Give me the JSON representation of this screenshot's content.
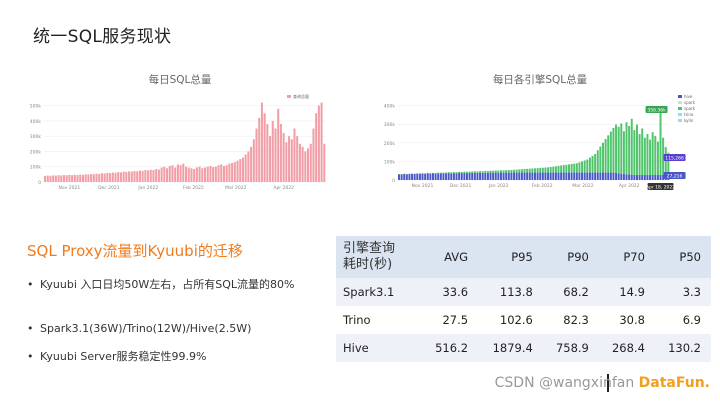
{
  "slide": {
    "title": "统一SQL服务现状"
  },
  "left_chart": {
    "title": "每日SQL总量",
    "chart_data": {
      "type": "bar",
      "title": "每日SQL总量",
      "legend": [
        "查询总量"
      ],
      "yticks": [
        "0",
        "100k",
        "200k",
        "300k",
        "400k",
        "500k"
      ],
      "ylim": [
        0,
        550000
      ],
      "xticks": [
        "Nov 2021",
        "Dec 2021",
        "Jan 2022",
        "Feb 2022",
        "Mar 2022",
        "Apr 2022"
      ],
      "series": [
        {
          "name": "查询总量",
          "color": "#f29ea6",
          "values": [
            40000,
            42000,
            41000,
            43000,
            42000,
            44000,
            43000,
            45000,
            44000,
            46000,
            45000,
            47000,
            46000,
            48000,
            47000,
            50000,
            49000,
            52000,
            51000,
            55000,
            53000,
            58000,
            56000,
            60000,
            58000,
            62000,
            60000,
            65000,
            63000,
            68000,
            66000,
            70000,
            68000,
            72000,
            70000,
            75000,
            73000,
            78000,
            76000,
            80000,
            78000,
            85000,
            82000,
            95000,
            100000,
            90000,
            105000,
            110000,
            95000,
            115000,
            110000,
            120000,
            100000,
            95000,
            90000,
            85000,
            95000,
            100000,
            90000,
            95000,
            100000,
            105000,
            98000,
            100000,
            110000,
            115000,
            105000,
            110000,
            120000,
            125000,
            130000,
            140000,
            150000,
            160000,
            180000,
            200000,
            230000,
            280000,
            350000,
            420000,
            520000,
            450000,
            380000,
            300000,
            400000,
            350000,
            480000,
            380000,
            320000,
            260000,
            300000,
            280000,
            350000,
            300000,
            250000,
            230000,
            200000,
            220000,
            250000,
            350000,
            450000,
            500000,
            520000,
            250000
          ]
        }
      ]
    }
  },
  "right_chart": {
    "title": "每日各引擎SQL总量",
    "chart_data": {
      "type": "bar",
      "title": "每日各引擎SQL总量",
      "legend": [
        "hive",
        "spark",
        "spark",
        "trino",
        "kylin"
      ],
      "yticks": [
        "0",
        "100k",
        "200k",
        "300k",
        "400k"
      ],
      "ylim": [
        0,
        430000
      ],
      "xticks": [
        "Nov 2021",
        "Dec 2021",
        "Jan 2022",
        "Feb 2022",
        "Mar 2022",
        "Apr 2022"
      ],
      "annotations": [
        "356.36k",
        "115,266",
        "27,216",
        "Apr 18, 2022"
      ],
      "series": [
        {
          "name": "hive",
          "color": "#4a57c9",
          "values": [
            30000,
            30000,
            32000,
            31000,
            32000,
            33000,
            32000,
            34000,
            33000,
            34000,
            33000,
            35000,
            34000,
            35000,
            34000,
            36000,
            35000,
            36000,
            35000,
            37000,
            36000,
            37000,
            36000,
            38000,
            37000,
            38000,
            37000,
            38000,
            38000,
            39000,
            38000,
            39000,
            38000,
            39000,
            38000,
            40000,
            39000,
            40000,
            39000,
            40000,
            39000,
            40000,
            39000,
            40000,
            40000,
            40000,
            40000,
            40000,
            40000,
            40000,
            40000,
            40000,
            40000,
            40000,
            40000,
            40000,
            40000,
            40000,
            40000,
            40000,
            40000,
            40000,
            40000,
            40000,
            40000,
            40000,
            40000,
            40000,
            40000,
            40000,
            40000,
            40000,
            40000,
            40000,
            40000,
            40000,
            40000,
            40000,
            40000,
            40000,
            40000,
            40000,
            40000,
            38000,
            36000,
            34000,
            32000,
            30000,
            30000,
            29000,
            28000,
            28000,
            27000,
            27000,
            27000,
            27000,
            27000,
            27000,
            27000,
            27000,
            27216,
            27000,
            27000,
            27000
          ]
        },
        {
          "name": "spark",
          "color": "#4fc46b",
          "values": [
            2000,
            2000,
            2000,
            2000,
            2000,
            2000,
            2000,
            2000,
            3000,
            3000,
            3000,
            3000,
            3000,
            3000,
            4000,
            4000,
            4000,
            4000,
            5000,
            5000,
            5000,
            5000,
            6000,
            6000,
            6000,
            7000,
            7000,
            7000,
            8000,
            8000,
            8000,
            9000,
            9000,
            10000,
            10000,
            10000,
            11000,
            11000,
            12000,
            12000,
            13000,
            13000,
            14000,
            14000,
            15000,
            16000,
            17000,
            18000,
            19000,
            20000,
            21000,
            22000,
            23000,
            24000,
            25000,
            26000,
            27000,
            28000,
            30000,
            32000,
            34000,
            36000,
            38000,
            40000,
            42000,
            44000,
            46000,
            48000,
            50000,
            55000,
            60000,
            65000,
            70000,
            80000,
            90000,
            100000,
            120000,
            140000,
            160000,
            180000,
            200000,
            220000,
            240000,
            260000,
            250000,
            270000,
            230000,
            280000,
            260000,
            300000,
            240000,
            270000,
            220000,
            250000,
            200000,
            220000,
            190000,
            230000,
            210000,
            180000,
            356360,
            200000,
            150000,
            120000
          ]
        },
        {
          "name": "trino",
          "color": "#5b3fd0",
          "values": [
            0,
            0,
            0,
            0,
            0,
            0,
            0,
            0,
            0,
            0,
            0,
            0,
            0,
            0,
            0,
            0,
            0,
            0,
            0,
            0,
            0,
            0,
            0,
            0,
            0,
            0,
            0,
            0,
            0,
            0,
            0,
            0,
            0,
            0,
            0,
            0,
            0,
            0,
            0,
            0,
            0,
            0,
            0,
            0,
            0,
            0,
            0,
            0,
            0,
            0,
            0,
            0,
            0,
            0,
            0,
            0,
            0,
            0,
            0,
            0,
            0,
            0,
            0,
            0,
            0,
            0,
            0,
            0,
            0,
            0,
            0,
            0,
            0,
            0,
            0,
            0,
            0,
            0,
            0,
            0,
            0,
            0,
            0,
            0,
            0,
            0,
            0,
            0,
            0,
            0,
            0,
            0,
            0,
            0,
            0,
            0,
            0,
            0,
            0,
            0,
            0,
            0,
            0,
            0
          ]
        },
        {
          "name": "kylin",
          "color": "#9ad8f5",
          "values": [
            0,
            0,
            0,
            0,
            0,
            0,
            0,
            0,
            0,
            0,
            0,
            0,
            0,
            0,
            0,
            0,
            0,
            0,
            0,
            0,
            0,
            0,
            0,
            0,
            0,
            0,
            0,
            0,
            0,
            0,
            0,
            0,
            0,
            0,
            0,
            0,
            0,
            0,
            0,
            0,
            0,
            0,
            0,
            0,
            0,
            0,
            0,
            0,
            0,
            0,
            0,
            0,
            0,
            0,
            0,
            0,
            0,
            0,
            0,
            0,
            0,
            0,
            0,
            0,
            0,
            0,
            0,
            0,
            0,
            0,
            0,
            0,
            0,
            0,
            0,
            0,
            0,
            0,
            0,
            0,
            0,
            0,
            0,
            0,
            0,
            0,
            0,
            0,
            0,
            0,
            0,
            0,
            0,
            0,
            0,
            0,
            0,
            0,
            0,
            0,
            0,
            0,
            0,
            0
          ]
        }
      ]
    }
  },
  "section": {
    "heading": "SQL Proxy流量到Kyuubi的迁移",
    "bullets": [
      "Kyuubi 入口日均50W左右，占所有SQL流量的80%",
      "Spark3.1(36W)/Trino(12W)/Hive(2.5W)",
      "Kyuubi Server服务稳定性99.9%"
    ]
  },
  "table": {
    "header": [
      "引擎查询耗时(秒)",
      "AVG",
      "P95",
      "P90",
      "P70",
      "P50"
    ],
    "rows": [
      [
        "Spark3.1",
        "33.6",
        "113.8",
        "68.2",
        "14.9",
        "3.3"
      ],
      [
        "Trino",
        "27.5",
        "102.6",
        "82.3",
        "30.8",
        "6.9"
      ],
      [
        "Hive",
        "516.2",
        "1879.4",
        "758.9",
        "268.4",
        "130.2"
      ]
    ]
  },
  "watermark": {
    "prefix": "CSDN",
    "handle": "@wangxinfan",
    "accent": "DataFun."
  }
}
